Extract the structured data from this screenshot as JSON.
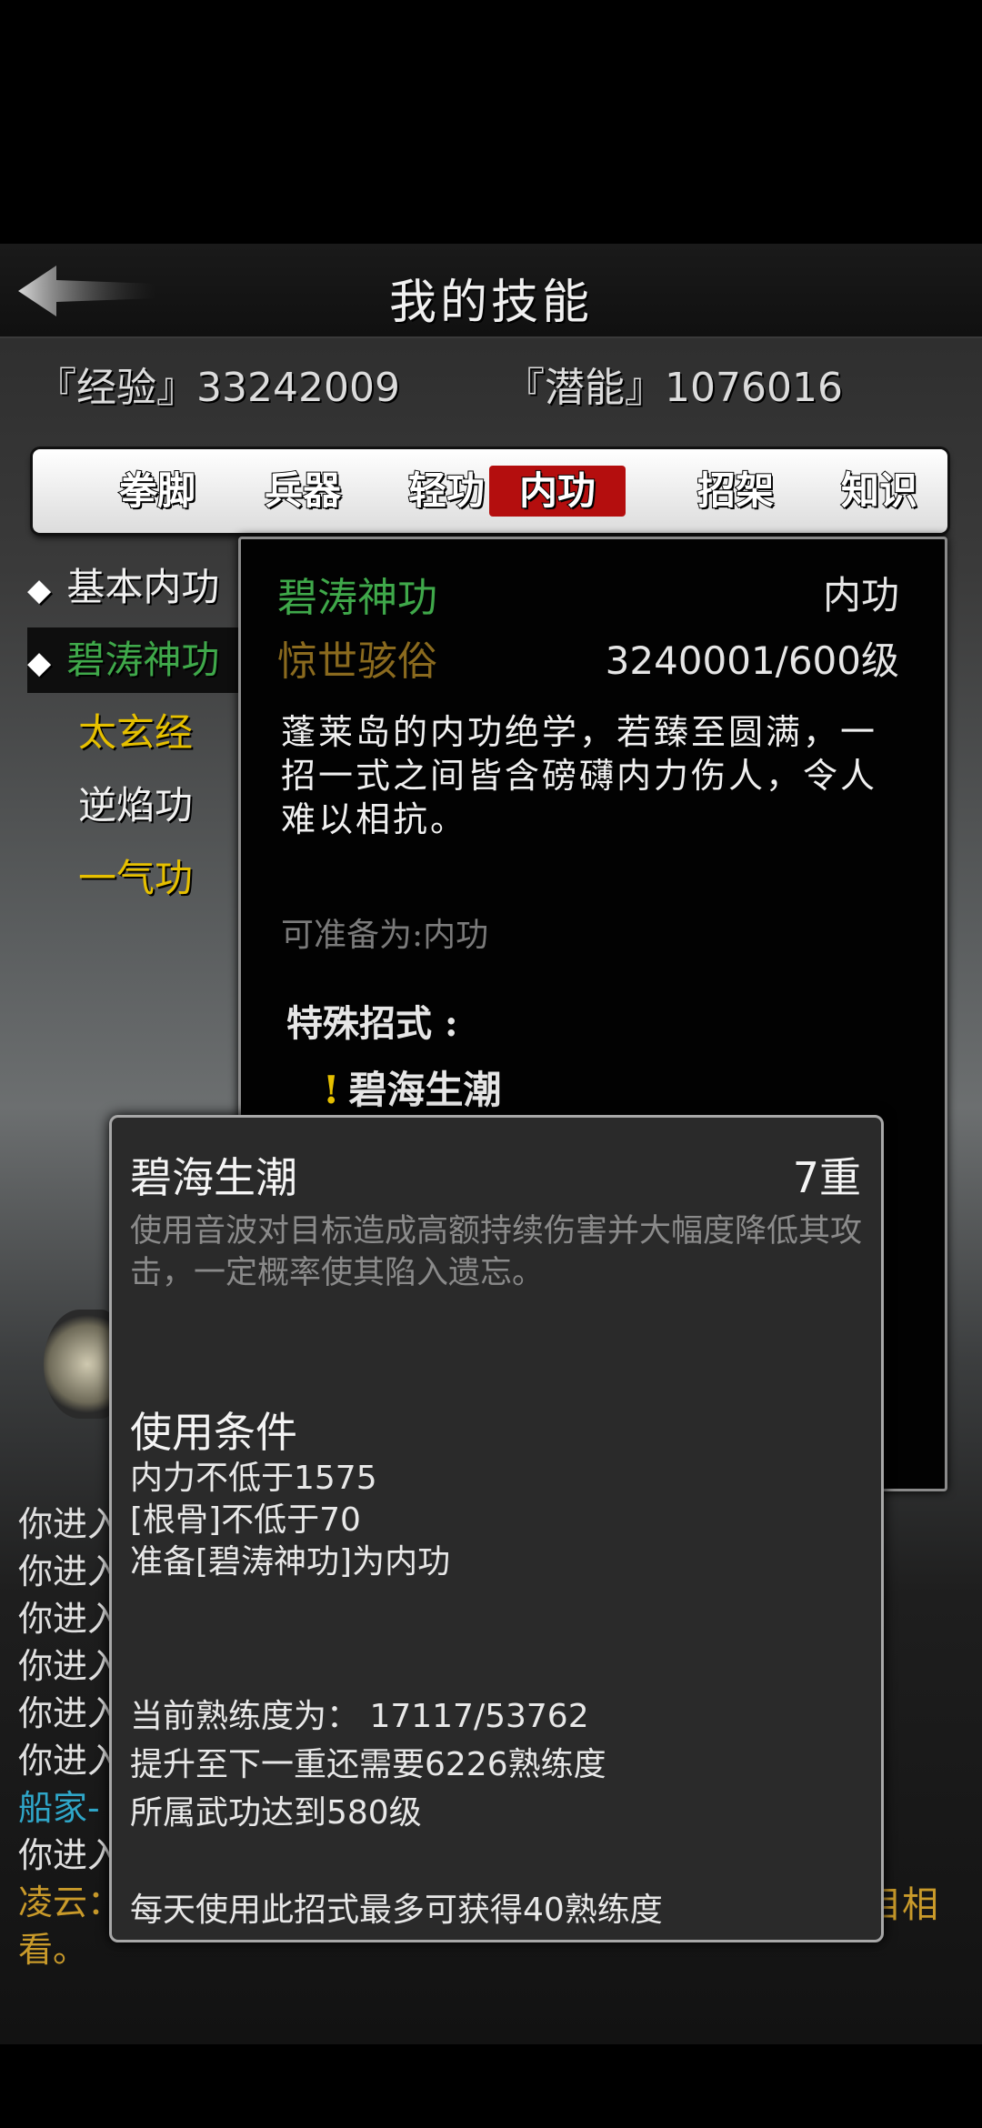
{
  "header": {
    "title": "我的技能",
    "back_icon": "back-arrow-icon"
  },
  "stats": {
    "experience": "『经验』33242009",
    "potential": "『潜能』1076016"
  },
  "tabs": [
    {
      "label": "拳脚",
      "active": false
    },
    {
      "label": "兵器",
      "active": false
    },
    {
      "label": "轻功",
      "active": false
    },
    {
      "label": "内功",
      "active": true
    },
    {
      "label": "招架",
      "active": false
    },
    {
      "label": "知识",
      "active": false
    }
  ],
  "skill_list": [
    {
      "label": "基本内功",
      "marker": "◆",
      "color": "#f0f0f0"
    },
    {
      "label": "碧涛神功",
      "marker": "◆",
      "color": "#3fa84a"
    },
    {
      "label": "太玄经",
      "marker": "",
      "color": "#e6c000"
    },
    {
      "label": "逆焰功",
      "marker": "",
      "color": "#f0f0f0"
    },
    {
      "label": "一气功",
      "marker": "",
      "color": "#e6c000"
    }
  ],
  "detail": {
    "name": "碧涛神功",
    "type": "内功",
    "level_name": "惊世骇俗",
    "level": "3240001/600级",
    "description": "蓬莱岛的内功绝学，若臻至圆满，一招一式之间皆含磅礴内力伤人，令人难以相抗。",
    "prepare": "可准备为:内功",
    "special_label": "特殊招式 :",
    "special_move": "碧海生潮",
    "special_marker": "!"
  },
  "chat_log": [
    {
      "text": "你进入",
      "color": "#e0e0e0"
    },
    {
      "text": "你进入",
      "color": "#e0e0e0"
    },
    {
      "text": "你进入",
      "color": "#e0e0e0"
    },
    {
      "text": "你进入",
      "color": "#e0e0e0"
    },
    {
      "text": "你进入",
      "color": "#e0e0e0"
    },
    {
      "text": "你进入",
      "color": "#e0e0e0"
    },
    {
      "text": "船家-",
      "color": "#2fa6c8"
    },
    {
      "text": "你进入",
      "color": "#e0e0e0"
    },
    {
      "text": "凌云：",
      "color": "#c99a2a"
    },
    {
      "text": "看。",
      "color": "#c99a2a"
    }
  ],
  "chat_tail": "目相",
  "popup": {
    "title": "碧海生潮",
    "rank": "7重",
    "description": "使用音波对目标造成高额持续伤害并大幅度降低其攻击，一定概率使其陷入遗忘。",
    "conditions_title": "使用条件",
    "conditions": [
      "内力不低于1575",
      "[根骨]不低于70",
      "准备[碧涛神功]为内功"
    ],
    "progress": [
      "当前熟练度为： 17117/53762",
      "提升至下一重还需要6226熟练度",
      "所属武功达到580级"
    ],
    "daily": "每天使用此招式最多可获得40熟练度"
  }
}
